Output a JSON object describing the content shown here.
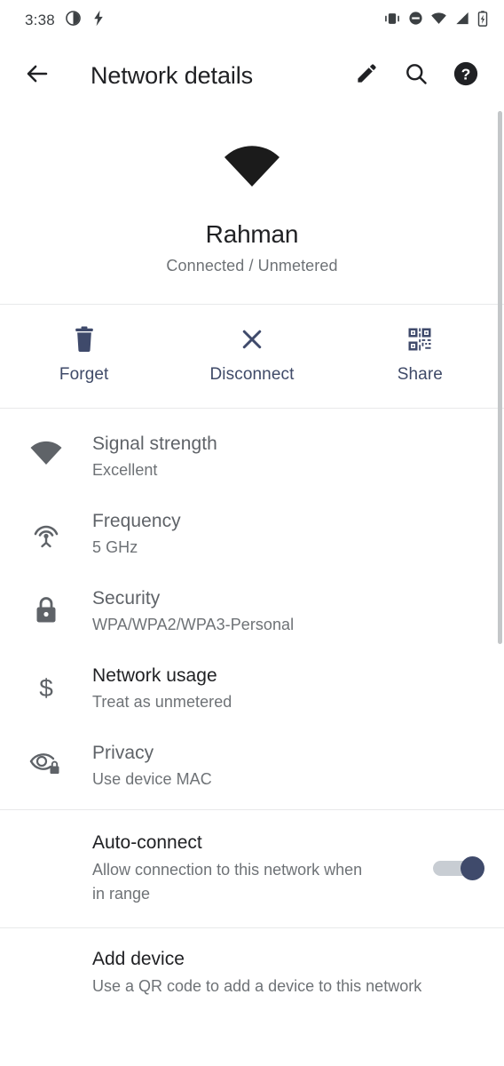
{
  "status_bar": {
    "clock": "3:38",
    "left_icons": [
      "contrast-icon",
      "flash-icon"
    ],
    "right_icons": [
      "vibrate-icon",
      "do-not-disturb-icon",
      "wifi-icon",
      "cellular-signal-icon",
      "battery-charging-icon"
    ]
  },
  "app_bar": {
    "back_icon": "arrow-back-icon",
    "title": "Network details",
    "actions": [
      {
        "icon": "edit-pencil-icon",
        "name": "edit-button"
      },
      {
        "icon": "search-icon",
        "name": "search-button"
      },
      {
        "icon": "help-icon",
        "name": "help-button"
      }
    ]
  },
  "hero": {
    "icon": "wifi-signal-full-icon",
    "ssid": "Rahman",
    "status": "Connected / Unmetered"
  },
  "actions": [
    {
      "label": "Forget",
      "icon": "trash-icon",
      "name": "forget-action"
    },
    {
      "label": "Disconnect",
      "icon": "close-x-icon",
      "name": "disconnect-action"
    },
    {
      "label": "Share",
      "icon": "qr-code-icon",
      "name": "share-action"
    }
  ],
  "details": [
    {
      "title": "Signal strength",
      "value": "Excellent",
      "icon": "wifi-signal-icon",
      "name": "signal-strength-row",
      "title_dark": false
    },
    {
      "title": "Frequency",
      "value": "5 GHz",
      "icon": "broadcast-antenna-icon",
      "name": "frequency-row",
      "title_dark": false
    },
    {
      "title": "Security",
      "value": "WPA/WPA2/WPA3-Personal",
      "icon": "lock-icon",
      "name": "security-row",
      "title_dark": false
    },
    {
      "title": "Network usage",
      "value": "Treat as unmetered",
      "icon": "dollar-sign-icon",
      "name": "network-usage-row",
      "title_dark": true
    },
    {
      "title": "Privacy",
      "value": "Use device MAC",
      "icon": "eye-lock-icon",
      "name": "privacy-row",
      "title_dark": false
    }
  ],
  "auto_connect": {
    "title": "Auto-connect",
    "subtitle": "Allow connection to this network when in range",
    "enabled": true
  },
  "add_device": {
    "title": "Add device",
    "subtitle": "Use a QR code to add a device to this network"
  },
  "colors": {
    "accent": "#3f4a6b",
    "title_text": "#202124",
    "secondary_text": "#6e7276",
    "divider": "#e8e9ea",
    "background": "#ffffff"
  }
}
